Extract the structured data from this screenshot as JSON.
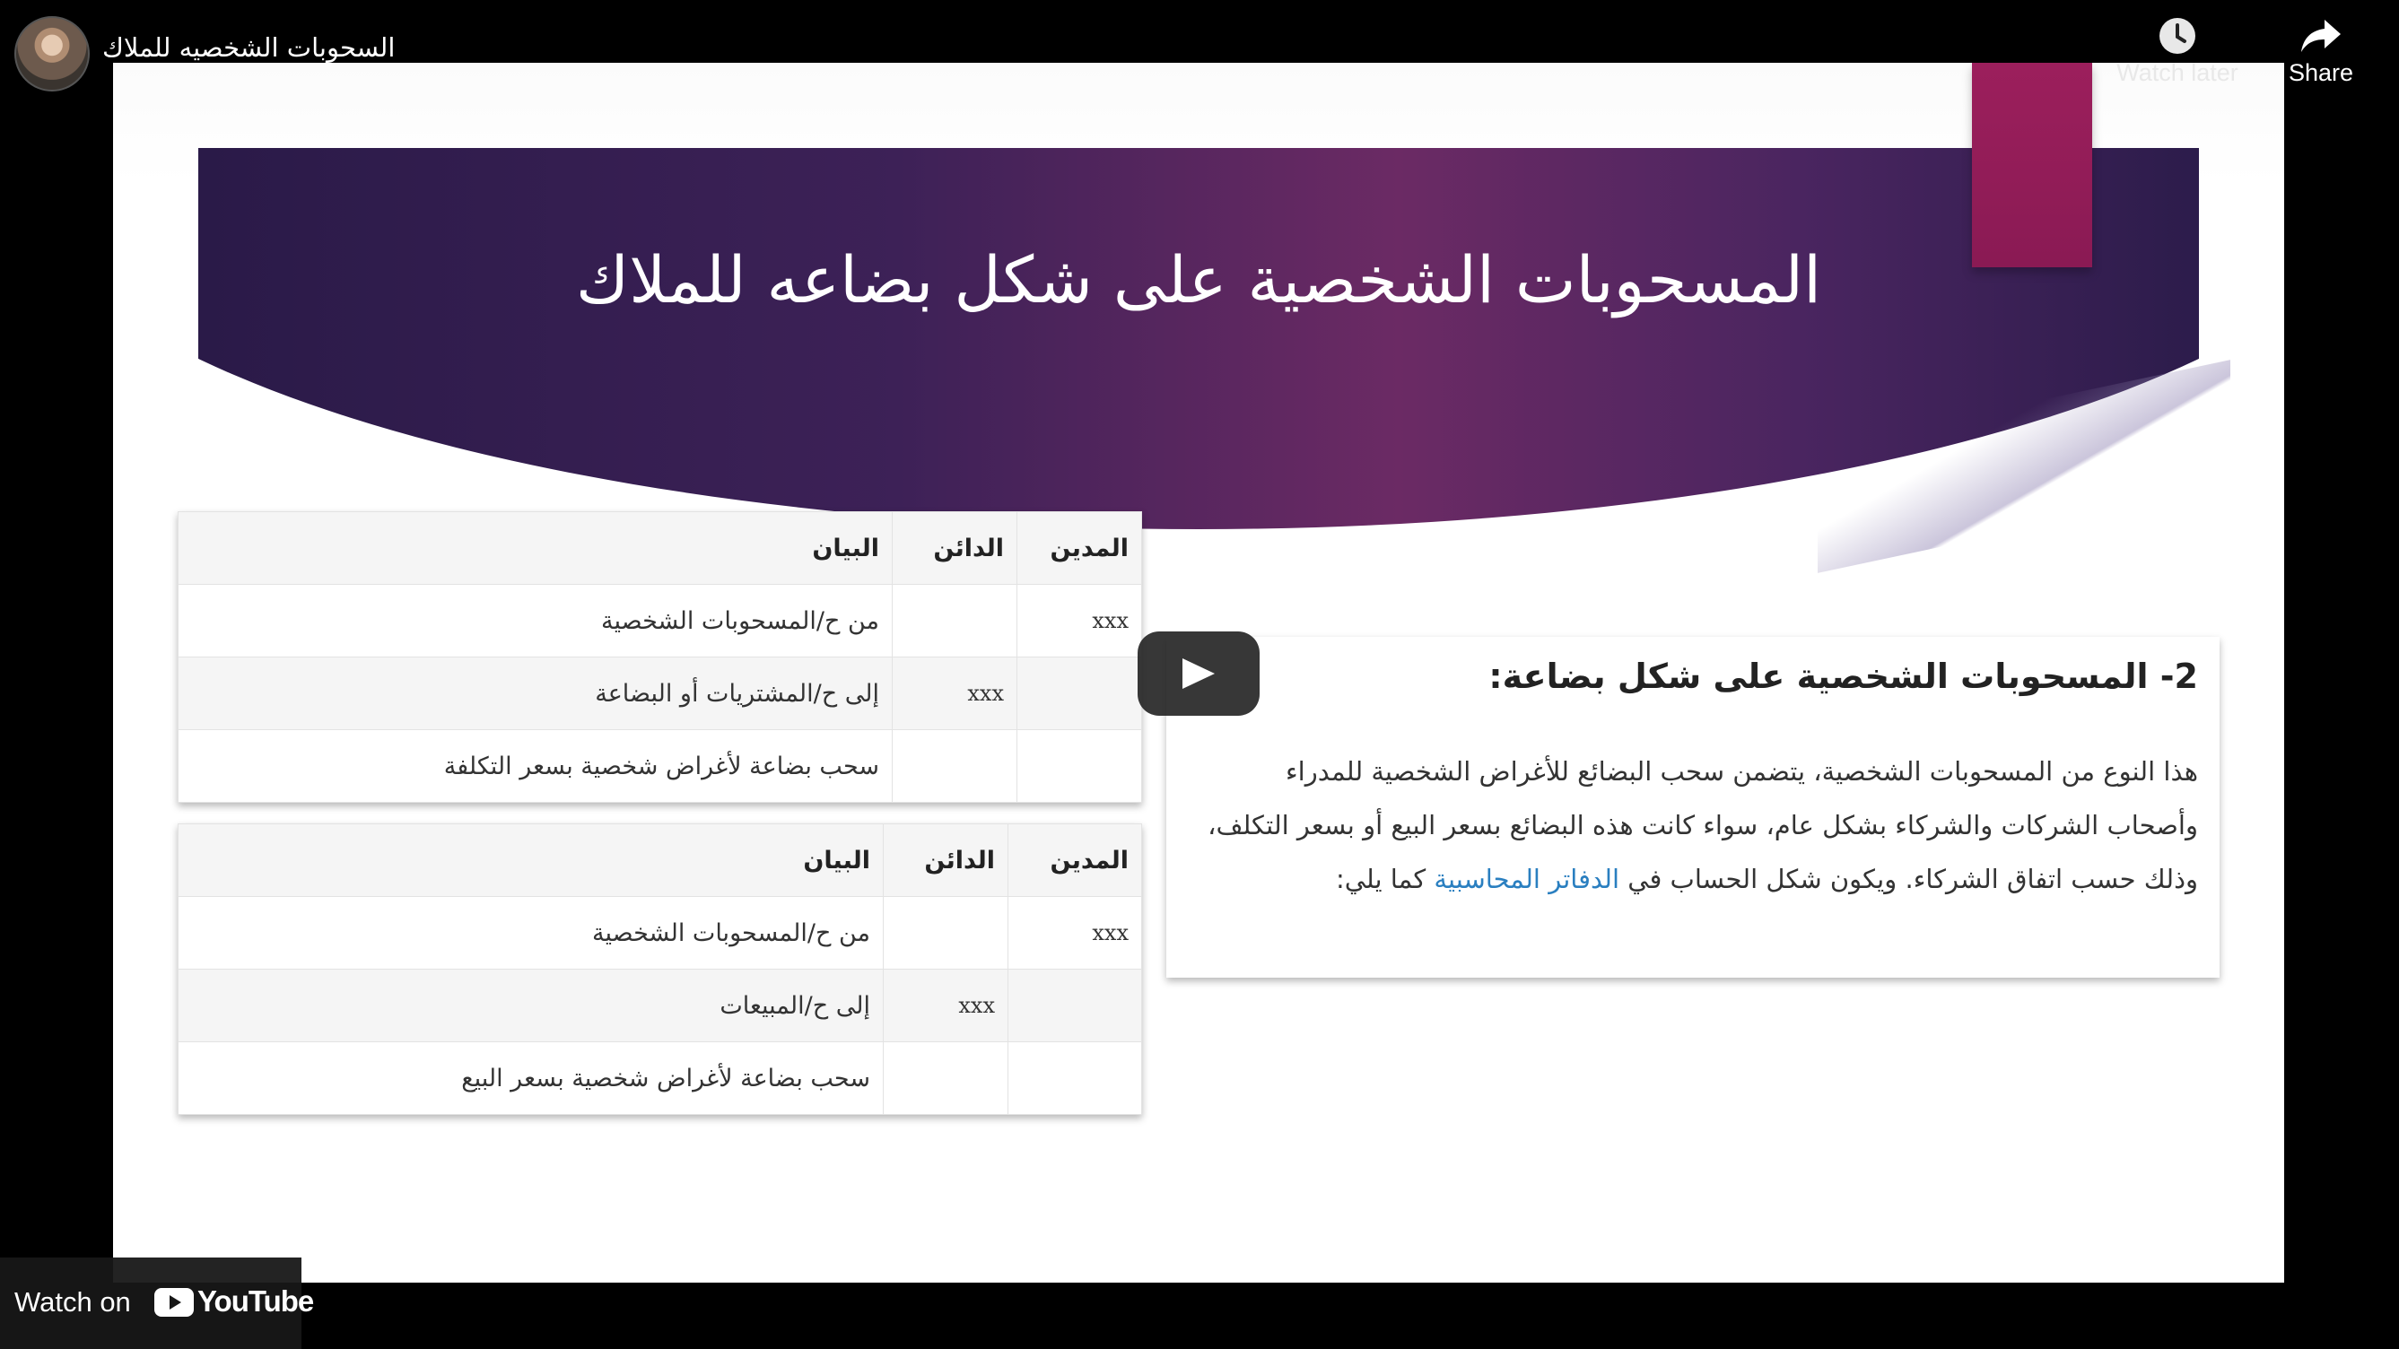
{
  "video": {
    "title": "السحوبات الشخصيه للملاك"
  },
  "actions": {
    "watch_later": "Watch later",
    "share": "Share"
  },
  "slide": {
    "title": "المسحوبات الشخصية على شكل بضاعه للملاك",
    "table_cost": {
      "headers": {
        "debit": "المدين",
        "credit": "الدائن",
        "description": "البيان"
      },
      "rows": [
        {
          "debit": "xxx",
          "credit": "",
          "description": "من ح/المسحوبات الشخصية"
        },
        {
          "debit": "",
          "credit": "xxx",
          "description": "إلى ح/المشتريات أو البضاعة"
        },
        {
          "debit": "",
          "credit": "",
          "description": "سحب بضاعة لأغراض شخصية بسعر التكلفة"
        }
      ]
    },
    "table_sale": {
      "headers": {
        "debit": "المدين",
        "credit": "الدائن",
        "description": "البيان"
      },
      "rows": [
        {
          "debit": "xxx",
          "credit": "",
          "description": "من ح/المسحوبات الشخصية"
        },
        {
          "debit": "",
          "credit": "xxx",
          "description": "إلى ح/المبيعات"
        },
        {
          "debit": "",
          "credit": "",
          "description": "سحب بضاعة لأغراض شخصية بسعر البيع"
        }
      ]
    },
    "card": {
      "heading": "2- المسحوبات الشخصية على شكل بضاعة:",
      "body_before_link": "هذا النوع من المسحوبات الشخصية، يتضمن سحب البضائع للأغراض الشخصية للمدراء وأصحاب الشركات والشركاء بشكل عام، سواء كانت هذه البضائع بسعر البيع أو بسعر التكلف، وذلك حسب اتفاق الشركاء. ويكون شكل الحساب في",
      "link_text": "الدفاتر المحاسبية",
      "body_after_link": "كما يلي:"
    }
  },
  "footer": {
    "watch_on": "Watch on",
    "brand": "YouTube"
  },
  "colors": {
    "accent": "#9c1f5c",
    "banner": "#2e1b4d",
    "link": "#2a7fc0"
  }
}
